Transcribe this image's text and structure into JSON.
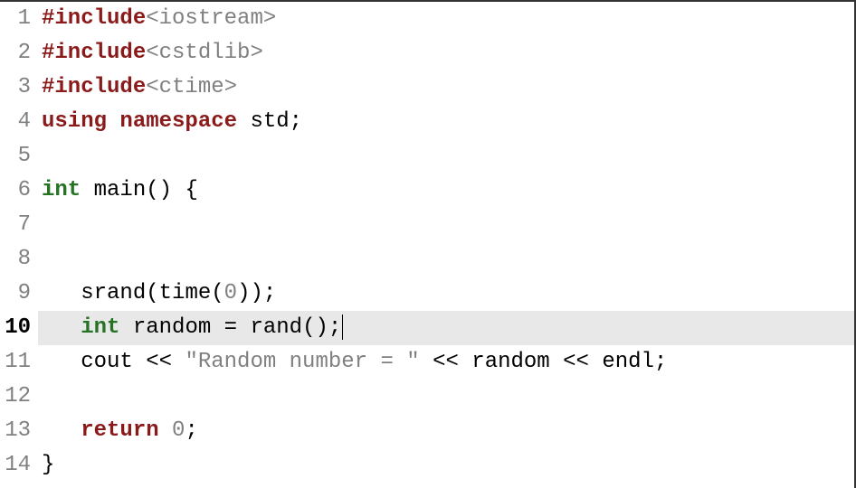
{
  "gutter": {
    "lines": [
      "1",
      "2",
      "3",
      "4",
      "5",
      "6",
      "7",
      "8",
      "9",
      "10",
      "11",
      "12",
      "13",
      "14"
    ],
    "bold_line": 10
  },
  "code": {
    "highlighted_line": 10,
    "lines": {
      "l1": {
        "pre": "#include",
        "open": "<",
        "header": "iostream",
        "close": ">"
      },
      "l2": {
        "pre": "#include",
        "open": "<",
        "header": "cstdlib",
        "close": ">"
      },
      "l3": {
        "pre": "#include",
        "open": "<",
        "header": "ctime",
        "close": ">"
      },
      "l4": {
        "kw1": "using",
        "kw2": "namespace",
        "rest": " std;"
      },
      "l5": "",
      "l6": {
        "type": "int",
        "rest": " main() {"
      },
      "l7": "",
      "l8": "",
      "l9": {
        "indent": "   ",
        "call": "srand(time(",
        "num": "0",
        "close": "));"
      },
      "l10": {
        "indent": "   ",
        "type": "int",
        "rest": " random = rand();"
      },
      "l11": {
        "indent": "   ",
        "pre": "cout << ",
        "str": "\"Random number = \"",
        "post": " << random << endl;"
      },
      "l12": "",
      "l13": {
        "indent": "   ",
        "kw": "return",
        "sp": " ",
        "num": "0",
        "semi": ";"
      },
      "l14": "}"
    }
  }
}
